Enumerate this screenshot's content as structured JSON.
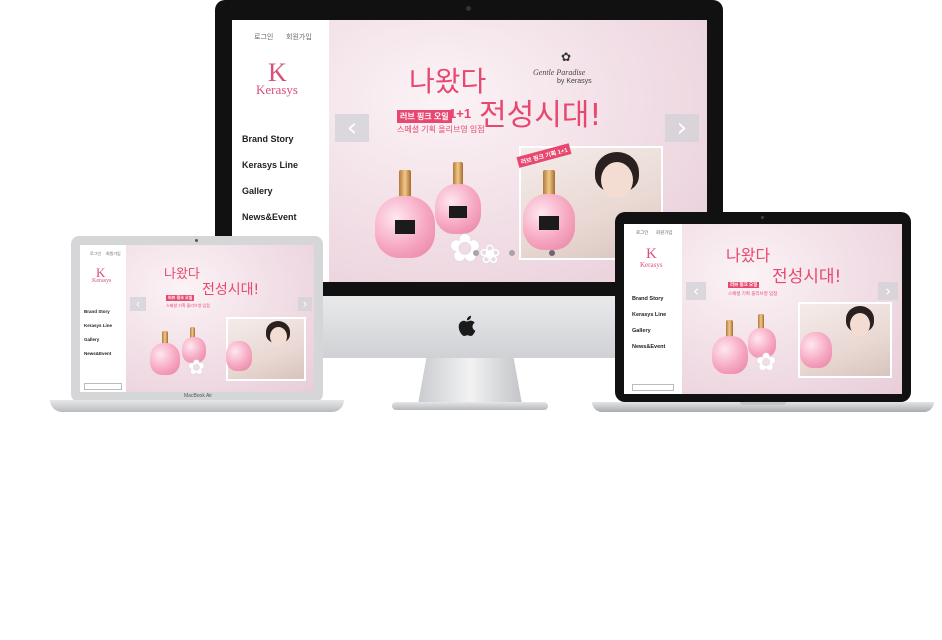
{
  "site": {
    "brand": "Kerasys",
    "logo_letter": "K",
    "top_links": [
      "로그인",
      "회원가입"
    ],
    "nav": [
      "Brand Story",
      "Kerasys Line",
      "Gallery",
      "News&Event"
    ],
    "headline_line1": "나왔다",
    "headline_line2": "전성시대!",
    "brand_script": "Gentle Paradise",
    "brand_by": "by Kerasys",
    "badge": "러브 핑크 오일",
    "badge_plus": "1+1",
    "sub_text": "스페셜 기획 올리브영 입점",
    "tag_text": "러브 핑크 기획 1+1",
    "prev_glyph": "‹",
    "next_glyph": "›"
  },
  "devices": {
    "laptop_left_label": "MacBook Air",
    "apple_logo": ""
  },
  "colors": {
    "accent": "#e8476f",
    "brand_pink": "#d94f7a"
  }
}
